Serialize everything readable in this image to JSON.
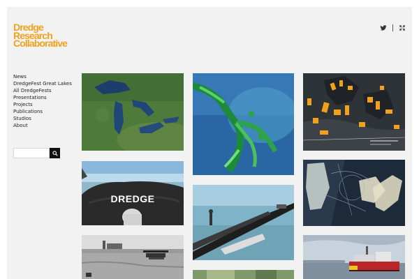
{
  "brand": {
    "logo_lines": [
      "Dredge",
      "Research",
      "Collaborative"
    ],
    "accent_color": "#f0a21e"
  },
  "social": {
    "icons": [
      "twitter-icon",
      "expand-icon"
    ]
  },
  "nav": {
    "items": [
      "News",
      "DredgeFest Great Lakes",
      "All DredgeFests",
      "Presentations",
      "Projects",
      "Publications",
      "Studios",
      "About"
    ]
  },
  "search": {
    "value": "",
    "placeholder": "",
    "icon": "search-icon"
  },
  "gallery": {
    "tiles": [
      {
        "subject": "great-lakes-satellite"
      },
      {
        "subject": "river-delta-satellite"
      },
      {
        "subject": "dark-site-plan-map"
      },
      {
        "subject": "dredge-rock-pipe",
        "overlay_text": "DREDGE"
      },
      {
        "subject": "geotube-pipeline-shore"
      },
      {
        "subject": "drawing-overlays-dark"
      },
      {
        "subject": "historic-seaplane-photo"
      },
      {
        "subject": "red-dredge-ship"
      },
      {
        "subject": "aerial-green-partial"
      }
    ]
  }
}
